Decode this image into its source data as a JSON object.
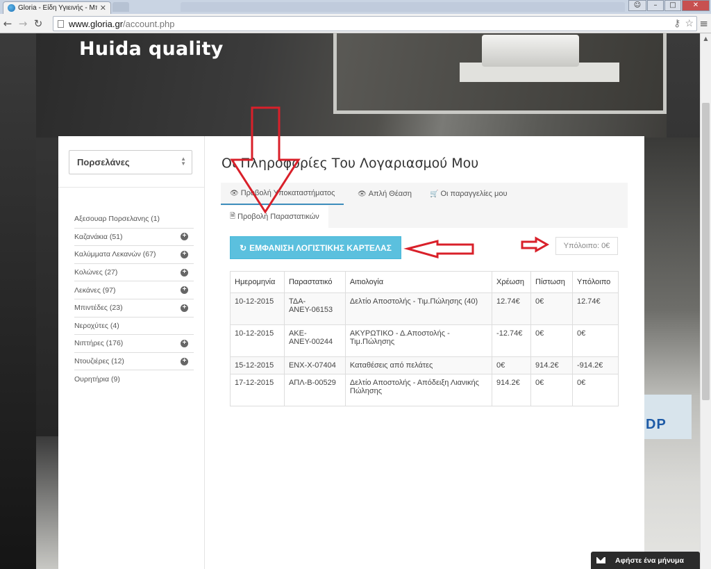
{
  "browser": {
    "tab_title": "Gloria - Είδη Υγιεινής - Μπ",
    "url_host": "www.gloria.gr",
    "url_path": "/account.php",
    "icons": [
      "back-icon",
      "forward-icon",
      "reload-icon",
      "page-icon",
      "bookmark-star-icon",
      "menu-icon"
    ]
  },
  "site": {
    "title": "Huida quality"
  },
  "sidebar": {
    "category_select": "Πορσελάνες",
    "items": [
      {
        "label": "Αξεσουαρ Πορσελανης (1)",
        "expandable": false
      },
      {
        "label": "Καζανάκια (51)",
        "expandable": true
      },
      {
        "label": "Καλύμματα Λεκανών (67)",
        "expandable": true
      },
      {
        "label": "Κολώνες (27)",
        "expandable": true
      },
      {
        "label": "Λεκάνες (97)",
        "expandable": true
      },
      {
        "label": "Μπιντέδες (23)",
        "expandable": true
      },
      {
        "label": "Νεροχύτες (4)",
        "expandable": false
      },
      {
        "label": "Νιπτήρες (176)",
        "expandable": true
      },
      {
        "label": "Ντουζιέρες (12)",
        "expandable": true
      },
      {
        "label": "Ουρητήρια (9)",
        "expandable": false
      }
    ]
  },
  "main": {
    "title": "Οι Πληροφορίες Του Λογαριασμού Μου",
    "tabs": [
      {
        "label": "Προβολή Υποκαταστήματος",
        "icon": "eye-icon"
      },
      {
        "label": "Απλή Θέαση",
        "icon": "eye-icon"
      },
      {
        "label": "Οι παραγγελίες μου",
        "icon": "cart-icon"
      },
      {
        "label": "Προβολή Παραστατικών",
        "icon": "document-icon"
      }
    ],
    "ledger_button": "ΕΜΦΑΝΙΣΗ ΛΟΓΙΣΤΙΚΗΣ ΚΑΡΤΕΛΑΣ",
    "balance": "Υπόλοιπο: 0€",
    "table": {
      "headers": [
        "Ημερομηνία",
        "Παραστατικό",
        "Αιτιολογία",
        "Χρέωση",
        "Πίστωση",
        "Υπόλοιπο"
      ],
      "rows": [
        [
          "10-12-2015",
          "ΤΔΑ-ΑΝΕΥ-06153",
          "Δελτίο Αποστολής - Τιμ.Πώλησης (40)",
          "12.74€",
          "0€",
          "12.74€"
        ],
        [
          "10-12-2015",
          "ΑΚΕ-ΑΝΕΥ-00244",
          "ΑΚΥΡΩΤΙΚΟ - Δ.Αποστολής - Τιμ.Πώλησης",
          "-12.74€",
          "0€",
          "0€"
        ],
        [
          "15-12-2015",
          "ΕΝΧ-Χ-07404",
          "Καταθέσεις από πελάτες",
          "0€",
          "914.2€",
          "-914.2€"
        ],
        [
          "17-12-2015",
          "ΑΠΛ-Β-00529",
          "Δελτίο Αποστολής - Απόδειξη Λιανικής Πώλησης",
          "914.2€",
          "0€",
          "0€"
        ]
      ]
    }
  },
  "chat": {
    "label": "Αφήστε ένα μήνυμα"
  },
  "colors": {
    "accent": "#5bc0de",
    "tab_active_border": "#3c8dbc",
    "annotation": "#d9202a"
  }
}
